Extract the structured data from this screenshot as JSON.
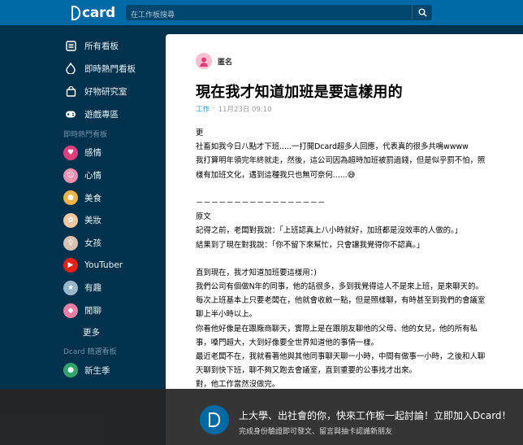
{
  "header": {
    "logo_text": "card",
    "search_placeholder": "在工作板搜尋"
  },
  "sidebar": {
    "main_items": [
      {
        "label": "所有看板",
        "icon": "list-icon"
      },
      {
        "label": "即時熱門看板",
        "icon": "flame-icon"
      },
      {
        "label": "好物研究室",
        "icon": "shopping-bag-icon"
      },
      {
        "label": "遊戲專區",
        "icon": "gamepad-icon"
      }
    ],
    "hot_title": "即時熱門看板",
    "hot_boards": [
      {
        "label": "感情",
        "icon": "heart-board-icon",
        "color": "#e0407a"
      },
      {
        "label": "心情",
        "icon": "mood-board-icon",
        "color": "#f08fb0"
      },
      {
        "label": "美食",
        "icon": "food-board-icon",
        "color": "#f2b44a"
      },
      {
        "label": "美妝",
        "icon": "makeup-board-icon",
        "color": "#f3c9a3"
      },
      {
        "label": "女孩",
        "icon": "girl-board-icon",
        "color": "#d9c3b0"
      },
      {
        "label": "YouTuber",
        "icon": "youtube-board-icon",
        "color": "#e62117"
      },
      {
        "label": "有趣",
        "icon": "funny-board-icon",
        "color": "#9ab7c9"
      },
      {
        "label": "閒聊",
        "icon": "chat-board-icon",
        "color": "#e87fa3"
      }
    ],
    "more_label": "更多",
    "picked_title": "Dcard 精選看板",
    "picked_boards": [
      {
        "label": "新生季",
        "icon": "freshman-board-icon",
        "color": "#2fa56b"
      }
    ]
  },
  "post": {
    "author": "匿名",
    "title": "現在我才知道加班是要這樣用的",
    "board": "工作",
    "date": "11月23日 09:10",
    "lines": [
      "更",
      "社畜如我今日八點才下班.....一打開Dcard超多人回應，代表真的很多共鳴wwww",
      "我打算明年領完年終就走，然後，這公司因為超時加班被罰過錢，但是似乎罰不怕，照",
      "樣有加班文化，遇到這種我只也無可奈何......😅",
      "",
      "－－－－－－－－－－－－－－－－－",
      "原文",
      "記得之前，老闆對我說：「上班認真上八小時就好，加班都是沒效率的人做的。」",
      "結果到了現在對我說：「你不留下來幫忙，只會讓我覺得你不認真。」",
      "",
      "直到現在，我才知道加班要這樣用：)",
      "我們公司有個做N年的同事，他的話很多，多到我覺得這人不是來上班，是來聊天的。",
      "每次上班基本上只要老闆在，他就會收斂一點，但是照樣聊，有時甚至到我們的會議室",
      "聊上半小時以上。",
      "你看他好像是在跟廠商聊天，實際上是在跟朋友聊他的父母、他的女兒，他的所有私",
      "事，嗓門超大，大到好像要全世界知道他的事情一樣。",
      "最近老闆不在，我就看著他與其他同事聊天聊一小時，中間有做事一小時，之後和人聊",
      "天聊到快下班，聊不夠又跑去會議室，直到重要的公事找才出來。",
      "對，他工作當然沒做完。"
    ]
  },
  "promo": {
    "title": "上大學、出社會的你，快來工作板一起討論！立即加入Dcard！",
    "subtitle": "完成身份驗證即可發文、留言與抽卡認識新朋友"
  }
}
